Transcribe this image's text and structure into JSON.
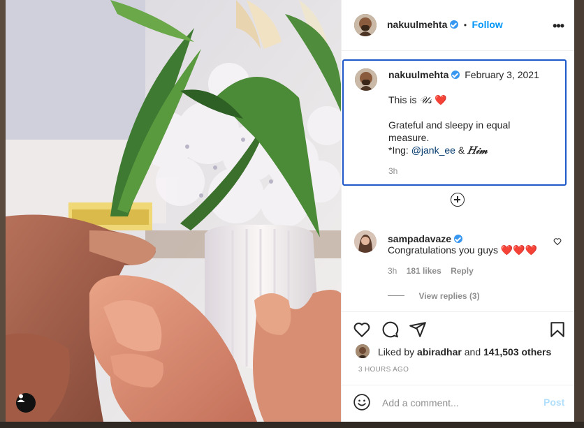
{
  "colors": {
    "accent": "#0095f6",
    "verified": "#3897f0",
    "focus_border": "#1f59c9",
    "heart": "#ed4956"
  },
  "header": {
    "username": "nakuulmehta",
    "separator": "•",
    "follow_label": "Follow",
    "more_label": "•••"
  },
  "caption": {
    "username": "nakuulmehta",
    "date": "February 3, 2021",
    "line1_prefix": "This is ",
    "line1_script": "𝒰𝓈",
    "line1_emoji": "❤️",
    "line2": "Grateful and sleepy in equal",
    "line3": "measure.",
    "line4_prefix": "*Ing: ",
    "line4_mention": "@jank_ee",
    "line4_amp": " & ",
    "line4_script": "𝐻𝒾𝓂",
    "time": "3h"
  },
  "comment": {
    "username": "sampadavaze",
    "text": "Congratulations you guys ❤️❤️❤️",
    "time": "3h",
    "likes": "181 likes",
    "reply_label": "Reply",
    "view_replies": "View replies (3)"
  },
  "likes": {
    "prefix": "Liked by ",
    "user": "abiradhar",
    "middle": " and ",
    "count": "141,503 others"
  },
  "timestamp": "3 HOURS AGO",
  "add_comment": {
    "placeholder": "Add a comment...",
    "post_label": "Post"
  },
  "icons": [
    "user-tag-icon",
    "verified-icon",
    "more-icon",
    "plus-circle-icon",
    "like-comment-icon",
    "heart-icon",
    "comment-icon",
    "share-icon",
    "bookmark-icon",
    "emoji-icon"
  ]
}
